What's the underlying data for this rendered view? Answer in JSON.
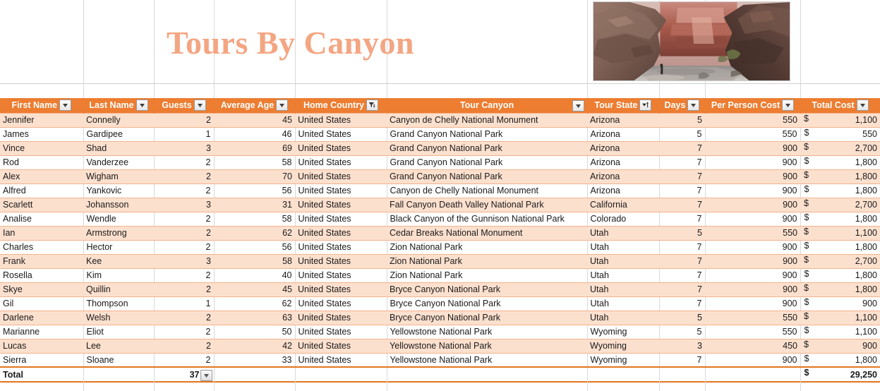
{
  "banner": {
    "title": "Tours By Canyon",
    "title_color": "#F4A582",
    "photo_alt": "canyon-river-photo"
  },
  "table": {
    "header_color": "#ED7D31",
    "band_color": "#FCE0CE",
    "columns": [
      {
        "label": "First Name",
        "icon": "filter-dropdown-icon",
        "align": "left"
      },
      {
        "label": "Last Name",
        "icon": "filter-dropdown-icon",
        "align": "left"
      },
      {
        "label": "Guests",
        "icon": "filter-dropdown-icon",
        "align": "right"
      },
      {
        "label": "Average Age",
        "icon": "filter-dropdown-icon",
        "align": "right"
      },
      {
        "label": "Home Country",
        "icon": "filter-active-icon",
        "align": "left"
      },
      {
        "label": "Tour Canyon",
        "icon": "filter-dropdown-icon",
        "align": "left"
      },
      {
        "label": "Tour State",
        "icon": "sort-ascending-icon",
        "align": "left"
      },
      {
        "label": "Days",
        "icon": "filter-dropdown-icon",
        "align": "right"
      },
      {
        "label": "Per Person Cost",
        "icon": "filter-dropdown-icon",
        "align": "right"
      },
      {
        "label": "Total Cost",
        "icon": "filter-dropdown-icon",
        "align": "right"
      }
    ],
    "rows": [
      {
        "first": "Jennifer",
        "last": "Connelly",
        "guests": "2",
        "age": "45",
        "country": "United States",
        "canyon": "Canyon de Chelly National Monument",
        "state": "Arizona",
        "days": "5",
        "per_person": "550",
        "total": "1,100"
      },
      {
        "first": "James",
        "last": "Gardipee",
        "guests": "1",
        "age": "46",
        "country": "United States",
        "canyon": "Grand Canyon National Park",
        "state": "Arizona",
        "days": "5",
        "per_person": "550",
        "total": "550"
      },
      {
        "first": "Vince",
        "last": "Shad",
        "guests": "3",
        "age": "69",
        "country": "United States",
        "canyon": "Grand Canyon National Park",
        "state": "Arizona",
        "days": "7",
        "per_person": "900",
        "total": "2,700"
      },
      {
        "first": "Rod",
        "last": "Vanderzee",
        "guests": "2",
        "age": "58",
        "country": "United States",
        "canyon": "Grand Canyon National Park",
        "state": "Arizona",
        "days": "7",
        "per_person": "900",
        "total": "1,800"
      },
      {
        "first": "Alex",
        "last": "Wigham",
        "guests": "2",
        "age": "70",
        "country": "United States",
        "canyon": "Grand Canyon National Park",
        "state": "Arizona",
        "days": "7",
        "per_person": "900",
        "total": "1,800"
      },
      {
        "first": "Alfred",
        "last": "Yankovic",
        "guests": "2",
        "age": "56",
        "country": "United States",
        "canyon": "Canyon de Chelly National Monument",
        "state": "Arizona",
        "days": "7",
        "per_person": "900",
        "total": "1,800"
      },
      {
        "first": "Scarlett",
        "last": "Johansson",
        "guests": "3",
        "age": "31",
        "country": "United States",
        "canyon": "Fall Canyon Death Valley National Park",
        "state": "California",
        "days": "7",
        "per_person": "900",
        "total": "2,700"
      },
      {
        "first": "Analise",
        "last": "Wendle",
        "guests": "2",
        "age": "58",
        "country": "United States",
        "canyon": "Black Canyon of the Gunnison National Park",
        "state": "Colorado",
        "days": "7",
        "per_person": "900",
        "total": "1,800"
      },
      {
        "first": "Ian",
        "last": "Armstrong",
        "guests": "2",
        "age": "62",
        "country": "United States",
        "canyon": "Cedar Breaks National Monument",
        "state": "Utah",
        "days": "5",
        "per_person": "550",
        "total": "1,100"
      },
      {
        "first": "Charles",
        "last": "Hector",
        "guests": "2",
        "age": "56",
        "country": "United States",
        "canyon": "Zion National Park",
        "state": "Utah",
        "days": "7",
        "per_person": "900",
        "total": "1,800"
      },
      {
        "first": "Frank",
        "last": "Kee",
        "guests": "3",
        "age": "58",
        "country": "United States",
        "canyon": "Zion National Park",
        "state": "Utah",
        "days": "7",
        "per_person": "900",
        "total": "2,700"
      },
      {
        "first": "Rosella",
        "last": "Kim",
        "guests": "2",
        "age": "40",
        "country": "United States",
        "canyon": "Zion National Park",
        "state": "Utah",
        "days": "7",
        "per_person": "900",
        "total": "1,800"
      },
      {
        "first": "Skye",
        "last": "Quillin",
        "guests": "2",
        "age": "45",
        "country": "United States",
        "canyon": "Bryce Canyon National Park",
        "state": "Utah",
        "days": "7",
        "per_person": "900",
        "total": "1,800"
      },
      {
        "first": "Gil",
        "last": "Thompson",
        "guests": "1",
        "age": "62",
        "country": "United States",
        "canyon": "Bryce Canyon National Park",
        "state": "Utah",
        "days": "7",
        "per_person": "900",
        "total": "900"
      },
      {
        "first": "Darlene",
        "last": "Welsh",
        "guests": "2",
        "age": "63",
        "country": "United States",
        "canyon": "Bryce Canyon National Park",
        "state": "Utah",
        "days": "5",
        "per_person": "550",
        "total": "1,100"
      },
      {
        "first": "Marianne",
        "last": "Eliot",
        "guests": "2",
        "age": "50",
        "country": "United States",
        "canyon": "Yellowstone National Park",
        "state": "Wyoming",
        "days": "5",
        "per_person": "550",
        "total": "1,100"
      },
      {
        "first": "Lucas",
        "last": "Lee",
        "guests": "2",
        "age": "42",
        "country": "United States",
        "canyon": "Yellowstone National Park",
        "state": "Wyoming",
        "days": "3",
        "per_person": "450",
        "total": "900"
      },
      {
        "first": "Sierra",
        "last": "Sloane",
        "guests": "2",
        "age": "33",
        "country": "United States",
        "canyon": "Yellowstone National Park",
        "state": "Wyoming",
        "days": "7",
        "per_person": "900",
        "total": "1,800"
      }
    ],
    "total_row": {
      "label": "Total",
      "guests": "37",
      "dollar": "$",
      "total_cost": "29,250",
      "dropdown_icon": "total-dropdown-icon"
    },
    "currency_symbol": "$"
  }
}
